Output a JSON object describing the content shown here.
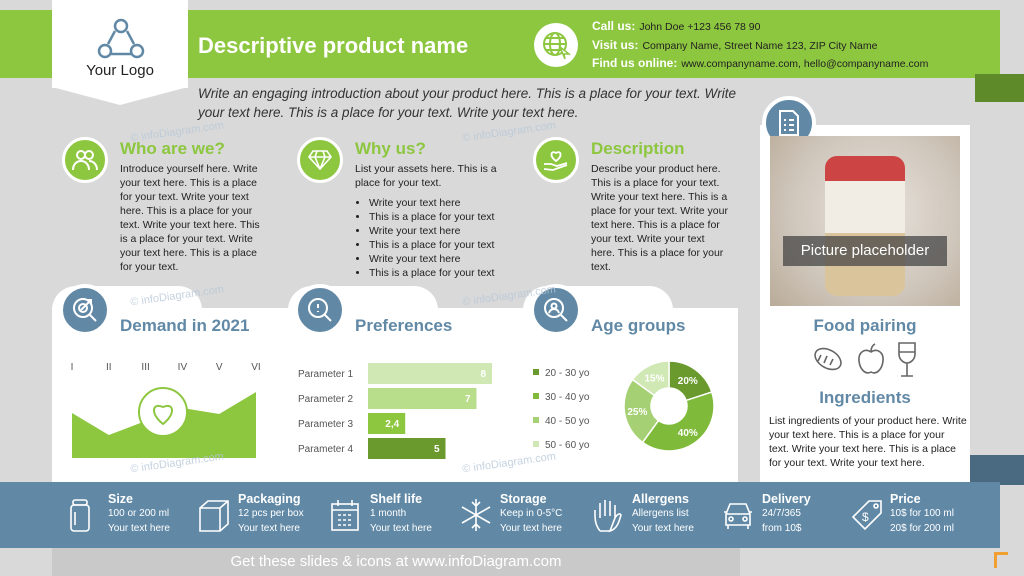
{
  "header": {
    "logo_text": "Your Logo",
    "title": "Descriptive product name",
    "contact": [
      {
        "label": "Call us:",
        "value": "John Doe +123 456 78 90"
      },
      {
        "label": "Visit us:",
        "value": "Company Name, Street Name 123, ZIP City Name"
      },
      {
        "label": "Find us online:",
        "value": "www.companyname.com, hello@companyname.com"
      }
    ]
  },
  "intro": "Write an engaging introduction about your product here. This is a place for your text. Write your text here. This is a place for your text. Write your text here.",
  "sections": {
    "who": {
      "title": "Who are we?",
      "text": "Introduce yourself here. Write your text here. This is a place for your text. Write your text here. This is a place for your text. Write your text here. This is a place for your text. Write your text here. This is a place for your text."
    },
    "why": {
      "title": "Why us?",
      "text": "List your assets here. This is a place for your text.",
      "bullets": [
        "Write your text here",
        "This is a place for your text",
        "Write your text here",
        "This is a place for your text",
        "Write your text here",
        "This is a place for your text"
      ]
    },
    "desc": {
      "title": "Description",
      "text": "Describe your product here. This is a place for your text. Write your text here. This is a place for your text. Write your text here. This is a place for your text. Write your text here. This is a place for your text."
    }
  },
  "demand": {
    "title": "Demand in 2021"
  },
  "preferences": {
    "title": "Preferences"
  },
  "age": {
    "title": "Age groups"
  },
  "chart_data": [
    {
      "type": "area",
      "categories": [
        "I",
        "II",
        "III",
        "IV",
        "V",
        "VI"
      ],
      "values": [
        45,
        23,
        37,
        50,
        44,
        66
      ]
    },
    {
      "type": "bar",
      "orientation": "horizontal",
      "categories": [
        "Parameter 1",
        "Parameter 2",
        "Parameter 3",
        "Parameter 4"
      ],
      "values": [
        8,
        7,
        2.4,
        5
      ],
      "data_labels": [
        "8",
        "7",
        "2,4",
        "5"
      ],
      "colors": [
        "#cfe8b4",
        "#b8de8c",
        "#8dc63f",
        "#6a9a2e"
      ]
    },
    {
      "type": "pie",
      "donut": true,
      "categories": [
        "20 - 30 yo",
        "30 - 40 yo",
        "40 - 50 yo",
        "50 - 60 yo"
      ],
      "values": [
        20,
        40,
        25,
        15
      ],
      "data_labels": [
        "20%",
        "40%",
        "25%",
        "15%"
      ],
      "colors": [
        "#6a9a2e",
        "#7fba3a",
        "#a5d174",
        "#cfe8b4"
      ],
      "legend": "left"
    }
  ],
  "right": {
    "picture": "Picture placeholder",
    "food_title": "Food pairing",
    "ingredients_title": "Ingredients",
    "ingredients_text": "List ingredients of your product here. Write your text here. This is a place for your text. Write your text here. This is a place for your text. Write your text here."
  },
  "features": [
    {
      "title": "Size",
      "l1": "100 or 200  ml",
      "l2": "Your text here",
      "icon": "jar-icon"
    },
    {
      "title": "Packaging",
      "l1": "12 pcs per box",
      "l2": "Your text here",
      "icon": "box-icon"
    },
    {
      "title": "Shelf life",
      "l1": "1 month",
      "l2": "Your text here",
      "icon": "calendar-icon"
    },
    {
      "title": "Storage",
      "l1": "Keep in 0-5°C",
      "l2": "Your text here",
      "icon": "snowflake-icon"
    },
    {
      "title": "Allergens",
      "l1": "Allergens list",
      "l2": "Your text here",
      "icon": "hand-icon"
    },
    {
      "title": "Delivery",
      "l1": "24/7/365",
      "l2": "from 10$",
      "icon": "car-icon"
    },
    {
      "title": "Price",
      "l1": "10$ for 100  ml",
      "l2": "20$ for 200  ml",
      "icon": "price-tag-icon"
    }
  ],
  "footer": "Get these slides & icons at www.infoDiagram.com",
  "watermark": "© infoDiagram.com",
  "colors": {
    "green": "#8dc63f",
    "blue": "#6189a6",
    "dark_green": "#6a9a2e"
  }
}
